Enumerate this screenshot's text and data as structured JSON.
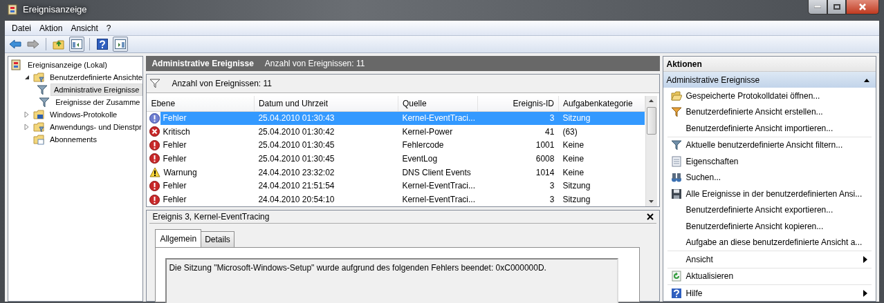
{
  "window": {
    "title": "Ereignisanzeige"
  },
  "menu": [
    "Datei",
    "Aktion",
    "Ansicht",
    "?"
  ],
  "tree": [
    {
      "label": "Ereignisanzeige (Lokal)",
      "kind": "root",
      "selected": false,
      "children": [
        {
          "label": "Benutzerdefinierte Ansichte",
          "kind": "folder",
          "expanded": true,
          "selected": false,
          "children": [
            {
              "label": "Administrative Ereignisse",
              "kind": "view",
              "selected": true
            },
            {
              "label": "Ereignisse der Zusamme",
              "kind": "view",
              "selected": false
            }
          ]
        },
        {
          "label": "Windows-Protokolle",
          "kind": "logs",
          "expanded": false,
          "selected": false
        },
        {
          "label": "Anwendungs- und Dienstpr",
          "kind": "folder",
          "expanded": false,
          "selected": false
        },
        {
          "label": "Abonnements",
          "kind": "subscriptions",
          "selected": false
        }
      ]
    }
  ],
  "view": {
    "title": "Administrative Ereignisse",
    "count": "Anzahl von Ereignissen: 11",
    "filter_count": "Anzahl von Ereignissen: 11",
    "columns": [
      "Ebene",
      "Datum und Uhrzeit",
      "Quelle",
      "Ereignis-ID",
      "Aufgabenkategorie"
    ],
    "rows": [
      {
        "level": "Fehler",
        "kind": "error",
        "date": "25.04.2010 01:30:43",
        "source": "Kernel-EventTraci...",
        "id": "3",
        "category": "Sitzung",
        "selected": true
      },
      {
        "level": "Kritisch",
        "kind": "critical",
        "date": "25.04.2010 01:30:42",
        "source": "Kernel-Power",
        "id": "41",
        "category": "(63)",
        "selected": false
      },
      {
        "level": "Fehler",
        "kind": "error",
        "date": "25.04.2010 01:30:45",
        "source": "Fehlercode",
        "id": "1001",
        "category": "Keine",
        "selected": false
      },
      {
        "level": "Fehler",
        "kind": "error",
        "date": "25.04.2010 01:30:45",
        "source": "EventLog",
        "id": "6008",
        "category": "Keine",
        "selected": false
      },
      {
        "level": "Warnung",
        "kind": "warning",
        "date": "24.04.2010 23:32:02",
        "source": "DNS Client Events",
        "id": "1014",
        "category": "Keine",
        "selected": false
      },
      {
        "level": "Fehler",
        "kind": "error",
        "date": "24.04.2010 21:51:54",
        "source": "Kernel-EventTraci...",
        "id": "3",
        "category": "Sitzung",
        "selected": false
      },
      {
        "level": "Fehler",
        "kind": "error",
        "date": "24.04.2010 20:54:10",
        "source": "Kernel-EventTraci...",
        "id": "3",
        "category": "Sitzung",
        "selected": false
      }
    ]
  },
  "details": {
    "title": "Ereignis 3, Kernel-EventTracing",
    "tabs": [
      {
        "label": "Allgemein",
        "selected": true
      },
      {
        "label": "Details",
        "selected": false
      }
    ],
    "message": "Die Sitzung \"Microsoft-Windows-Setup\" wurde aufgrund des folgenden Fehlers beendet: 0xC000000D."
  },
  "actions": {
    "title": "Aktionen",
    "section": {
      "title": "Administrative Ereignisse",
      "expanded": true
    },
    "items": [
      {
        "kind": "open",
        "label": "Gespeicherte Protokolldatei öffnen...",
        "submenu": false
      },
      {
        "kind": "create",
        "label": "Benutzerdefinierte Ansicht erstellen...",
        "submenu": false
      },
      {
        "kind": "plain",
        "label": "Benutzerdefinierte Ansicht importieren...",
        "submenu": false
      },
      {
        "kind": "separator"
      },
      {
        "kind": "filter",
        "label": "Aktuelle benutzerdefinierte Ansicht filtern...",
        "submenu": false
      },
      {
        "kind": "properties",
        "label": "Eigenschaften",
        "submenu": false
      },
      {
        "kind": "find",
        "label": "Suchen...",
        "submenu": false
      },
      {
        "kind": "save",
        "label": "Alle Ereignisse in der benutzerdefinierten Ansi...",
        "submenu": false
      },
      {
        "kind": "plain",
        "label": "Benutzerdefinierte Ansicht exportieren...",
        "submenu": false
      },
      {
        "kind": "plain",
        "label": "Benutzerdefinierte Ansicht kopieren...",
        "submenu": false
      },
      {
        "kind": "plain",
        "label": "Aufgabe an diese benutzerdefinierte Ansicht a...",
        "submenu": false
      },
      {
        "kind": "separator"
      },
      {
        "kind": "plain",
        "label": "Ansicht",
        "submenu": true
      },
      {
        "kind": "separator"
      },
      {
        "kind": "refresh",
        "label": "Aktualisieren",
        "submenu": false
      },
      {
        "kind": "separator"
      },
      {
        "kind": "help",
        "label": "Hilfe",
        "submenu": true
      }
    ]
  }
}
